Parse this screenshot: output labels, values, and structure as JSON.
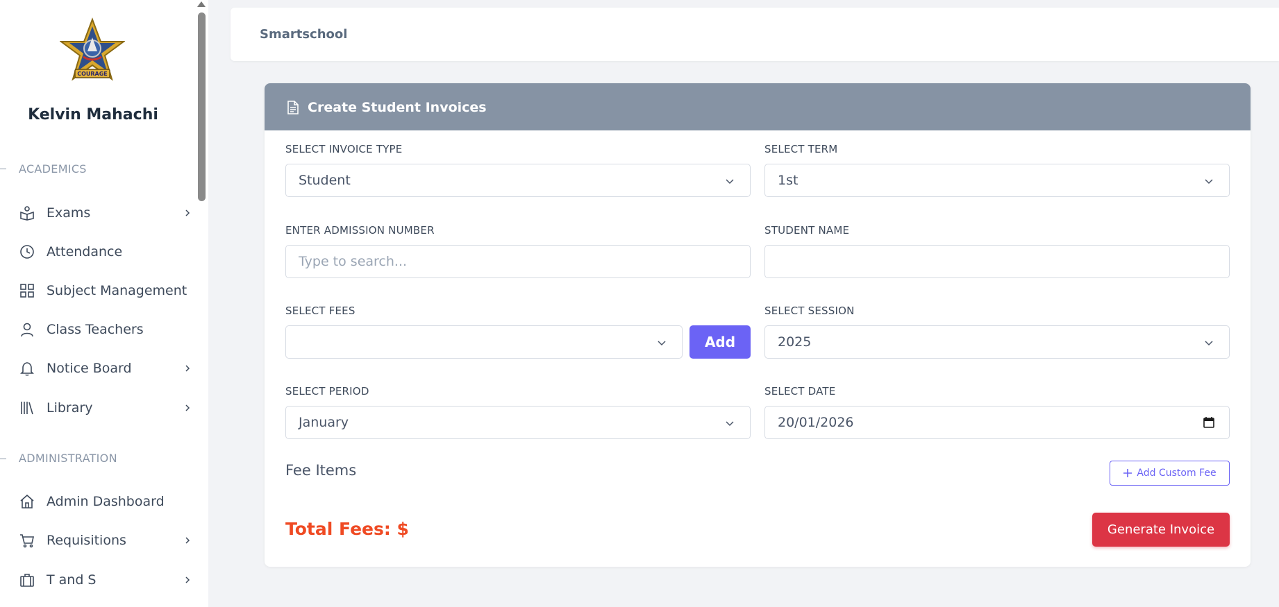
{
  "sidebar": {
    "user_name": "Kelvin Mahachi",
    "logo_text": "COURAGE",
    "sections": {
      "academics": "ACADEMICS",
      "administration": "ADMINISTRATION"
    },
    "items": [
      {
        "label": "Exams",
        "icon": "book-reader-icon",
        "has_children": true
      },
      {
        "label": "Attendance",
        "icon": "clock-icon",
        "has_children": false
      },
      {
        "label": "Subject Management",
        "icon": "grid-icon",
        "has_children": false
      },
      {
        "label": "Class Teachers",
        "icon": "user-icon",
        "has_children": false
      },
      {
        "label": "Notice Board",
        "icon": "bell-icon",
        "has_children": true
      },
      {
        "label": "Library",
        "icon": "library-icon",
        "has_children": true
      },
      {
        "label": "Admin Dashboard",
        "icon": "home-icon",
        "has_children": false
      },
      {
        "label": "Requisitions",
        "icon": "cart-icon",
        "has_children": true
      },
      {
        "label": "T and S",
        "icon": "briefcase-icon",
        "has_children": true
      }
    ]
  },
  "topbar": {
    "brand": "Smartschool"
  },
  "form": {
    "title": "Create Student Invoices",
    "invoice_type": {
      "label": "SELECT INVOICE TYPE",
      "value": "Student"
    },
    "term": {
      "label": "SELECT TERM",
      "value": "1st"
    },
    "admission": {
      "label": "ENTER ADMISSION NUMBER",
      "value": "",
      "placeholder": "Type to search..."
    },
    "student_name": {
      "label": "STUDENT NAME",
      "value": ""
    },
    "fees": {
      "label": "SELECT FEES",
      "value": "",
      "add_label": "Add"
    },
    "session": {
      "label": "SELECT SESSION",
      "value": "2025"
    },
    "period": {
      "label": "SELECT PERIOD",
      "value": "January"
    },
    "date": {
      "label": "SELECT DATE",
      "value": "20/01/2026"
    },
    "fee_items_title": "Fee Items",
    "add_custom_fee_label": "Add Custom Fee",
    "total_label": "Total Fees: $",
    "generate_label": "Generate Invoice"
  },
  "colors": {
    "header_bg": "#8693a4",
    "primary": "#6b63f5",
    "danger": "#dc3545",
    "total": "#ef4a23"
  }
}
